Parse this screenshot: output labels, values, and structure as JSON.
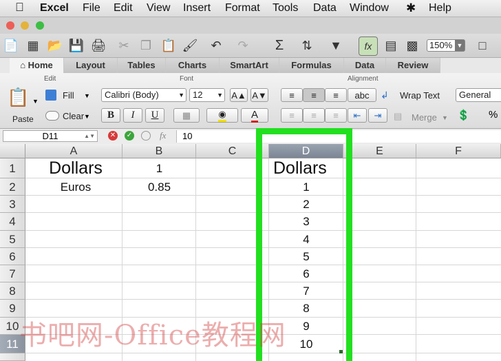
{
  "menubar": {
    "app": "Excel",
    "items": [
      "File",
      "Edit",
      "View",
      "Insert",
      "Format",
      "Tools",
      "Data",
      "Window",
      "Help"
    ]
  },
  "toolbar": {
    "zoom": "150%"
  },
  "ribbon": {
    "tabs": [
      "Home",
      "Layout",
      "Tables",
      "Charts",
      "SmartArt",
      "Formulas",
      "Data",
      "Review"
    ],
    "active_tab": "Home",
    "groups": {
      "edit": "Edit",
      "font": "Font",
      "alignment": "Alignment"
    },
    "paste_label": "Paste",
    "fill_label": "Fill",
    "clear_label": "Clear",
    "font_name": "Calibri (Body)",
    "font_size": "12",
    "bold": "B",
    "italic": "I",
    "underline": "U",
    "wrap_text": "Wrap Text",
    "merge": "Merge",
    "number_format": "General",
    "abc": "abc"
  },
  "formula_bar": {
    "cell_ref": "D11",
    "fx": "fx",
    "value": "10"
  },
  "grid": {
    "columns": [
      "A",
      "B",
      "C",
      "D",
      "E",
      "F"
    ],
    "rows": [
      "1",
      "2",
      "3",
      "4",
      "5",
      "6",
      "7",
      "8",
      "9",
      "10",
      "11"
    ],
    "cells": {
      "A1": "Dollars",
      "B1": "1",
      "A2": "Euros",
      "B2": "0.85",
      "D1": "Dollars",
      "D2": "1",
      "D3": "2",
      "D4": "3",
      "D5": "4",
      "D6": "5",
      "D7": "6",
      "D8": "7",
      "D9": "8",
      "D10": "9",
      "D11": "10"
    }
  },
  "colors": {
    "highlight": "#22e01f",
    "watermark": "#d23c3c"
  },
  "watermark": "书吧网-Office教程网"
}
